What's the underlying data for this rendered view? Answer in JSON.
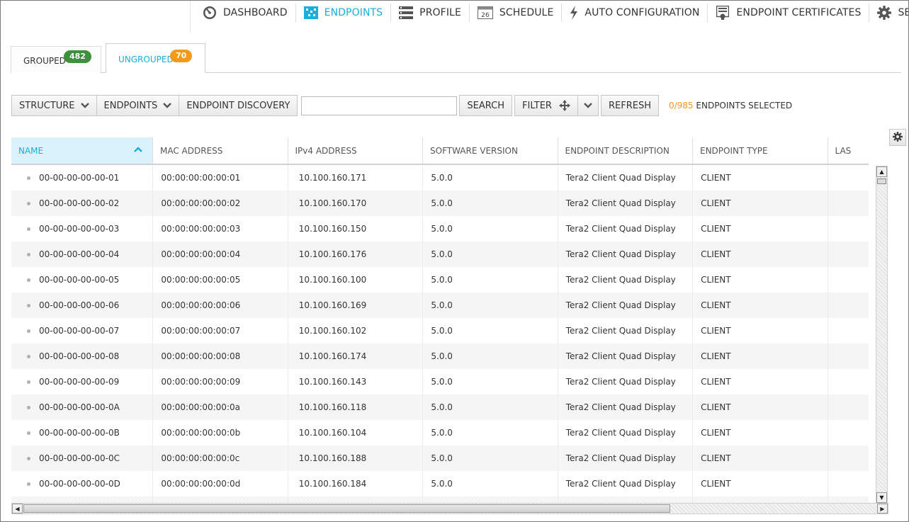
{
  "nav": {
    "items": [
      {
        "label": "DASHBOARD",
        "icon": "dashboard-gauge-icon"
      },
      {
        "label": "ENDPOINTS",
        "icon": "endpoints-grid-icon",
        "active": true
      },
      {
        "label": "PROFILE",
        "icon": "profile-list-icon"
      },
      {
        "label": "SCHEDULE",
        "icon": "calendar-icon",
        "calendar_day": "26"
      },
      {
        "label": "AUTO CONFIGURATION",
        "icon": "lightning-icon"
      },
      {
        "label": "ENDPOINT CERTIFICATES",
        "icon": "certificate-icon"
      },
      {
        "label": "SETTINGS",
        "icon": "gear-icon"
      }
    ],
    "active_color": "#1aaed8"
  },
  "tabs": {
    "grouped": {
      "label": "GROUPED",
      "count": "482",
      "badge_color": "#3e8f3e"
    },
    "ungrouped": {
      "label": "UNGROUPED",
      "count": "70",
      "badge_color": "#f39a1d",
      "active": true
    }
  },
  "toolbar": {
    "structure_label": "STRUCTURE",
    "endpoints_label": "ENDPOINTS",
    "discovery_label": "ENDPOINT DISCOVERY",
    "search_value": "",
    "search_label": "SEARCH",
    "filter_label": "FILTER",
    "refresh_label": "REFRESH",
    "selected_count": "0/985",
    "selected_suffix": "ENDPOINTS SELECTED"
  },
  "table": {
    "columns": [
      "NAME",
      "MAC ADDRESS",
      "IPv4 ADDRESS",
      "SOFTWARE VERSION",
      "ENDPOINT DESCRIPTION",
      "ENDPOINT TYPE",
      "LAS"
    ],
    "sorted_column": "NAME",
    "rows": [
      {
        "name": "00-00-00-00-00-01",
        "mac": "00:00:00:00:00:01",
        "ip": "10.100.160.171",
        "version": "5.0.0",
        "description": "Tera2 Client Quad Display",
        "type": "CLIENT"
      },
      {
        "name": "00-00-00-00-00-02",
        "mac": "00:00:00:00:00:02",
        "ip": "10.100.160.170",
        "version": "5.0.0",
        "description": "Tera2 Client Quad Display",
        "type": "CLIENT"
      },
      {
        "name": "00-00-00-00-00-03",
        "mac": "00:00:00:00:00:03",
        "ip": "10.100.160.150",
        "version": "5.0.0",
        "description": "Tera2 Client Quad Display",
        "type": "CLIENT"
      },
      {
        "name": "00-00-00-00-00-04",
        "mac": "00:00:00:00:00:04",
        "ip": "10.100.160.176",
        "version": "5.0.0",
        "description": "Tera2 Client Quad Display",
        "type": "CLIENT"
      },
      {
        "name": "00-00-00-00-00-05",
        "mac": "00:00:00:00:00:05",
        "ip": "10.100.160.100",
        "version": "5.0.0",
        "description": "Tera2 Client Quad Display",
        "type": "CLIENT"
      },
      {
        "name": "00-00-00-00-00-06",
        "mac": "00:00:00:00:00:06",
        "ip": "10.100.160.169",
        "version": "5.0.0",
        "description": "Tera2 Client Quad Display",
        "type": "CLIENT"
      },
      {
        "name": "00-00-00-00-00-07",
        "mac": "00:00:00:00:00:07",
        "ip": "10.100.160.102",
        "version": "5.0.0",
        "description": "Tera2 Client Quad Display",
        "type": "CLIENT"
      },
      {
        "name": "00-00-00-00-00-08",
        "mac": "00:00:00:00:00:08",
        "ip": "10.100.160.174",
        "version": "5.0.0",
        "description": "Tera2 Client Quad Display",
        "type": "CLIENT"
      },
      {
        "name": "00-00-00-00-00-09",
        "mac": "00:00:00:00:00:09",
        "ip": "10.100.160.143",
        "version": "5.0.0",
        "description": "Tera2 Client Quad Display",
        "type": "CLIENT"
      },
      {
        "name": "00-00-00-00-00-0A",
        "mac": "00:00:00:00:00:0a",
        "ip": "10.100.160.118",
        "version": "5.0.0",
        "description": "Tera2 Client Quad Display",
        "type": "CLIENT"
      },
      {
        "name": "00-00-00-00-00-0B",
        "mac": "00:00:00:00:00:0b",
        "ip": "10.100.160.104",
        "version": "5.0.0",
        "description": "Tera2 Client Quad Display",
        "type": "CLIENT"
      },
      {
        "name": "00-00-00-00-00-0C",
        "mac": "00:00:00:00:00:0c",
        "ip": "10.100.160.188",
        "version": "5.0.0",
        "description": "Tera2 Client Quad Display",
        "type": "CLIENT"
      },
      {
        "name": "00-00-00-00-00-0D",
        "mac": "00:00:00:00:00:0d",
        "ip": "10.100.160.184",
        "version": "5.0.0",
        "description": "Tera2 Client Quad Display",
        "type": "CLIENT"
      },
      {
        "name": "",
        "mac": "",
        "ip": "",
        "version": "",
        "description": "",
        "type": ""
      }
    ]
  }
}
